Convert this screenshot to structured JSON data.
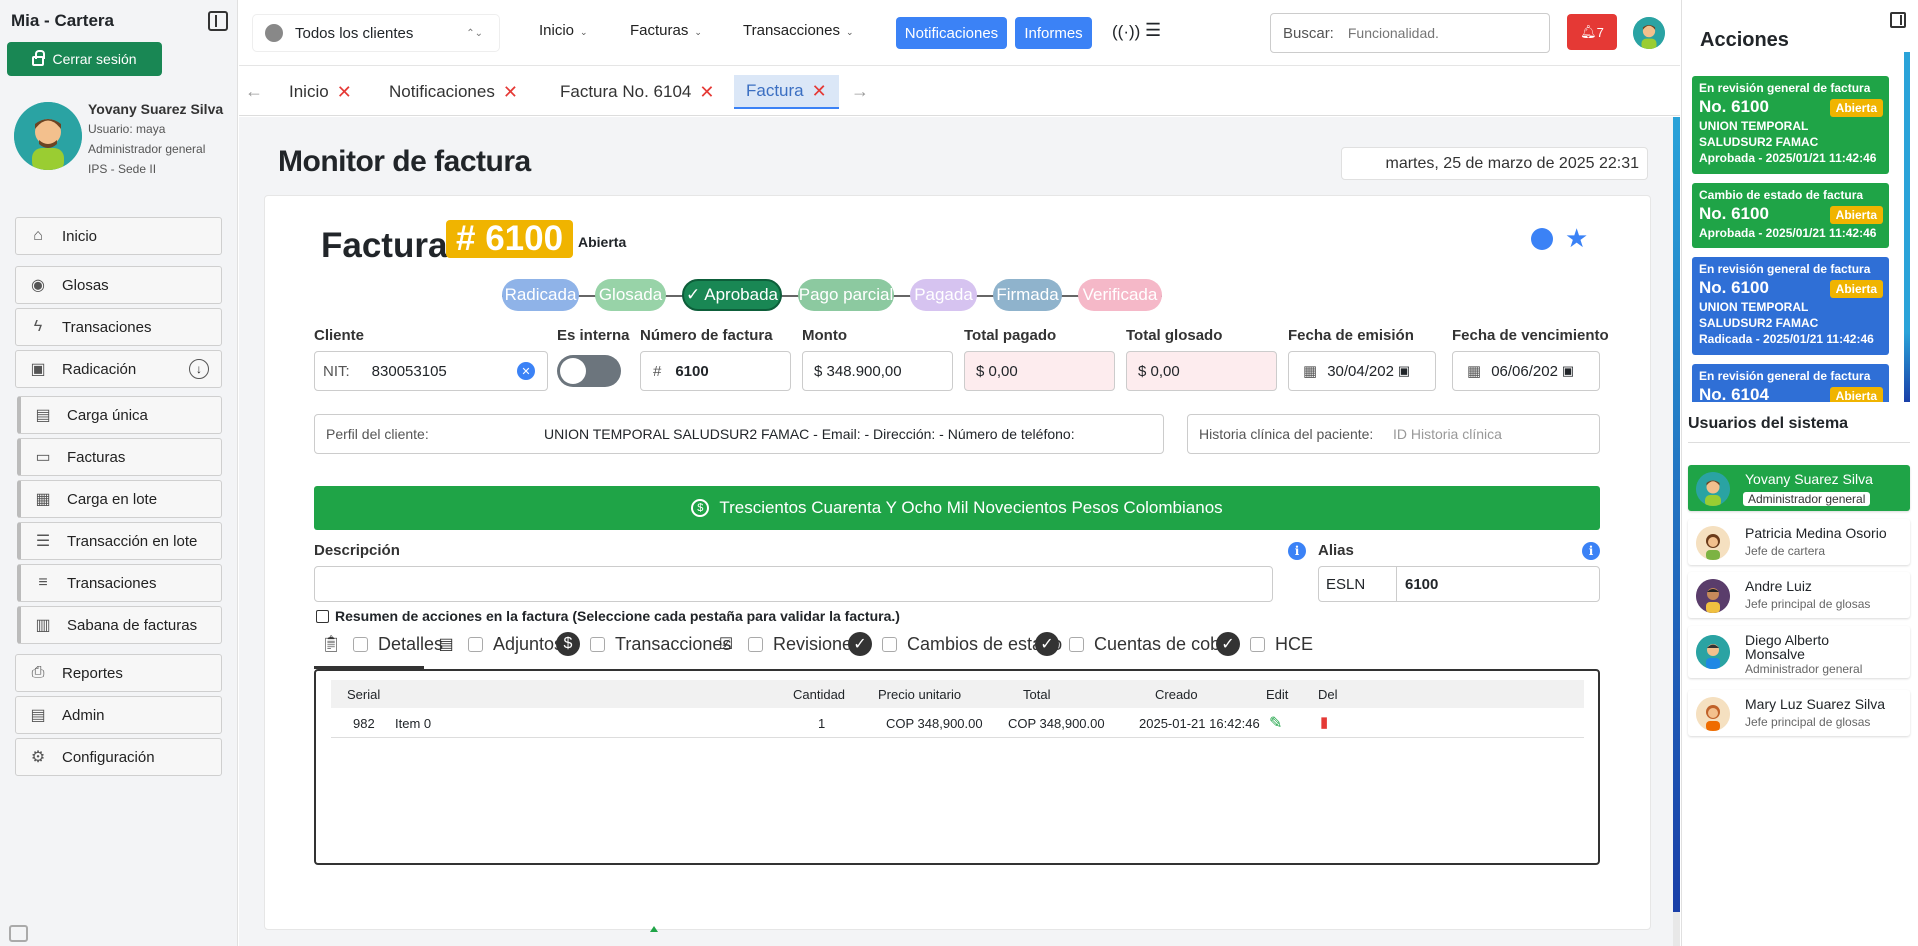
{
  "app": {
    "title": "Mia - Cartera"
  },
  "sidebar": {
    "logout_label": "Cerrar sesión",
    "user": {
      "name": "Yovany Suarez Silva",
      "username": "Usuario: maya",
      "role": "Administrador general",
      "site": "IPS - Sede II"
    },
    "items": [
      {
        "label": "Inicio",
        "icon": "home-icon"
      },
      {
        "label": "Glosas",
        "icon": "check-circle-icon"
      },
      {
        "label": "Transaciones",
        "icon": "bolt-icon"
      },
      {
        "label": "Radicación",
        "icon": "radicacion-icon"
      },
      {
        "label": "Carga única",
        "icon": "clipboard-icon"
      },
      {
        "label": "Facturas",
        "icon": "card-icon"
      },
      {
        "label": "Carga en lote",
        "icon": "chip-icon"
      },
      {
        "label": "Transacción en lote",
        "icon": "list-icon"
      },
      {
        "label": "Transaciones",
        "icon": "stack-icon"
      },
      {
        "label": "Sabana de facturas",
        "icon": "briefcase-icon"
      },
      {
        "label": "Reportes",
        "icon": "printer-icon"
      },
      {
        "label": "Admin",
        "icon": "server-icon"
      },
      {
        "label": "Configuración",
        "icon": "gear-icon"
      }
    ]
  },
  "topbar": {
    "client_select": "Todos los clientes",
    "menu": [
      "Inicio",
      "Facturas",
      "Transacciones"
    ],
    "notificaciones": "Notificaciones",
    "informes": "Informes",
    "search_label": "Buscar:",
    "search_placeholder": "Funcionalidad.",
    "bell_count": "7"
  },
  "tabs": [
    {
      "label": "Inicio"
    },
    {
      "label": "Notificaciones"
    },
    {
      "label": "Factura No. 6104"
    },
    {
      "label": "Factura",
      "active": true
    }
  ],
  "main": {
    "title": "Monitor de factura",
    "date": "martes, 25 de marzo de 2025 22:31",
    "factura": {
      "label": "Factura",
      "number": "# 6100",
      "state": "Abierta"
    },
    "steps": [
      {
        "label": "Radicada",
        "color": "#8fb3e8"
      },
      {
        "label": "Glosada",
        "color": "#98d3a8"
      },
      {
        "label": "Aprobada",
        "color": "#198754",
        "check": "✓"
      },
      {
        "label": "Pago parcial",
        "color": "#8cc9a0"
      },
      {
        "label": "Pagada",
        "color": "#d6c3f0"
      },
      {
        "label": "Firmada",
        "color": "#8fb3cc"
      },
      {
        "label": "Verificada",
        "color": "#f5b8c8"
      }
    ],
    "fields": {
      "cliente_label": "Cliente",
      "nit_prefix": "NIT:",
      "nit_value": "830053105",
      "interna_label": "Es interna",
      "numero_label": "Número de factura",
      "numero_prefix": "#",
      "numero_value": "6100",
      "monto_label": "Monto",
      "monto_value": "$ 348.900,00",
      "pagado_label": "Total pagado",
      "pagado_value": "$ 0,00",
      "glosado_label": "Total glosado",
      "glosado_value": "$ 0,00",
      "emision_label": "Fecha de emisión",
      "emision_value": "30/04/202",
      "vencimiento_label": "Fecha de vencimiento",
      "vencimiento_value": "06/06/202",
      "perfil_label": "Perfil del cliente:",
      "perfil_value": "UNION TEMPORAL SALUDSUR2 FAMAC - Email:  - Dirección:  - Número de teléfono:",
      "historia_label": "Historia clínica del paciente:",
      "historia_placeholder": "ID Historia clínica",
      "amount_words": "Trescientos Cuarenta Y Ocho Mil Novecientos Pesos Colombianos",
      "descripcion_label": "Descripción",
      "alias_label": "Alias",
      "alias_prefix": "ESLN",
      "alias_value": "6100"
    },
    "summary_text": "Resumen de acciones en la factura (Seleccione cada pestaña para validar la factura.)",
    "panel_tabs": [
      "Detalles",
      "Adjuntos",
      "Transacciones",
      "Revisiones",
      "Cambios de estado",
      "Cuentas de cobro",
      "HCE"
    ],
    "table": {
      "headers": [
        "Serial",
        "Cantidad",
        "Precio unitario",
        "Total",
        "Creado",
        "Edit",
        "Del"
      ],
      "rows": [
        {
          "serial": "982",
          "item": "Item 0",
          "cantidad": "1",
          "precio": "COP 348,900.00",
          "total": "COP 348,900.00",
          "creado": "2025-01-21 16:42:46"
        }
      ]
    }
  },
  "right": {
    "acciones_title": "Acciones",
    "acciones": [
      {
        "title": "En revisión general de factura",
        "number": "No. 6100",
        "badge": "Abierta",
        "company": "UNION TEMPORAL SALUDSUR2 FAMAC",
        "status": "Aprobada - 2025/01/21 11:42:46",
        "color": "#1fa447"
      },
      {
        "title": "Cambio de estado de factura",
        "number": "No. 6100",
        "badge": "Abierta",
        "company": "",
        "status": "Aprobada - 2025/01/21 11:42:46",
        "color": "#1fa447"
      },
      {
        "title": "En revisión general de factura",
        "number": "No. 6100",
        "badge": "Abierta",
        "company": "UNION TEMPORAL SALUDSUR2 FAMAC",
        "status": "Radicada - 2025/01/21 11:42:46",
        "color": "#2f6fd6"
      },
      {
        "title": "En revisión general de factura",
        "number": "No. 6104",
        "badge": "Abierta",
        "company": "",
        "status": "",
        "color": "#2f6fd6"
      }
    ],
    "usuarios_title": "Usuarios del sistema",
    "usuarios": [
      {
        "name": "Yovany Suarez Silva",
        "role": "Administrador general",
        "active": true
      },
      {
        "name": "Patricia Medina Osorio",
        "role": "Jefe de cartera"
      },
      {
        "name": "Andre Luiz",
        "role": "Jefe principal de glosas"
      },
      {
        "name": "Diego Alberto Monsalve",
        "role": "Administrador general"
      },
      {
        "name": "Mary Luz Suarez Silva",
        "role": "Jefe principal de glosas"
      }
    ]
  }
}
